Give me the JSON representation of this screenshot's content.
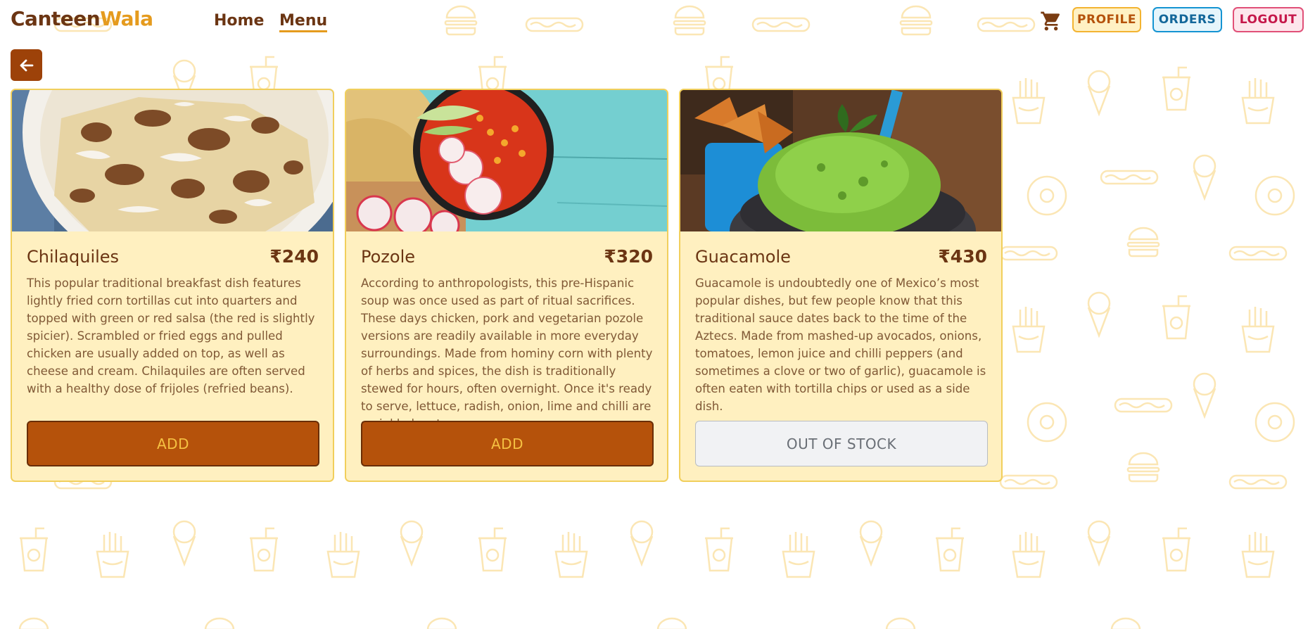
{
  "brand": {
    "part1": "Canteen",
    "part2": "Wala"
  },
  "nav": {
    "home": "Home",
    "menu": "Menu"
  },
  "actions": {
    "profile": "PROFILE",
    "orders": "ORDERS",
    "logout": "LOGOUT"
  },
  "colors": {
    "brand_dark": "#6b3513",
    "brand_accent": "#e59b1e",
    "card_bg": "#fff0c0",
    "add_button": "#b5520b",
    "pattern": "#fbe6b4"
  },
  "icons": {
    "cart": "cart-icon",
    "back": "arrow-left-icon"
  },
  "items": [
    {
      "name": "Chilaquiles",
      "price": "₹240",
      "description": "This popular traditional breakfast dish features lightly fried corn tortillas cut into quarters and topped with green or red salsa (the red is slightly spicier). Scrambled or fried eggs and pulled chicken are usually added on top, as well as cheese and cream. Chilaquiles are often served with a healthy dose of frijoles (refried beans).",
      "button": "ADD"
    },
    {
      "name": "Pozole",
      "price": "₹320",
      "description": "According to anthropologists, this pre-Hispanic soup was once used as part of ritual sacrifices. These days chicken, pork and vegetarian pozole versions are readily available in more everyday surroundings. Made from hominy corn with plenty of herbs and spices, the dish is traditionally stewed for hours, often overnight. Once it's ready to serve, lettuce, radish, onion, lime and chilli are sprinkled on top.",
      "button": "ADD"
    },
    {
      "name": "Guacamole",
      "price": "₹430",
      "description": "Guacamole is undoubtedly one of Mexico’s most popular dishes, but few people know that this traditional sauce dates back to the time of the Aztecs. Made from mashed-up avocados, onions, tomatoes, lemon juice and chilli peppers (and sometimes a clove or two of garlic), guacamole is often eaten with tortilla chips or used as a side dish.",
      "button": "OUT OF STOCK"
    }
  ]
}
